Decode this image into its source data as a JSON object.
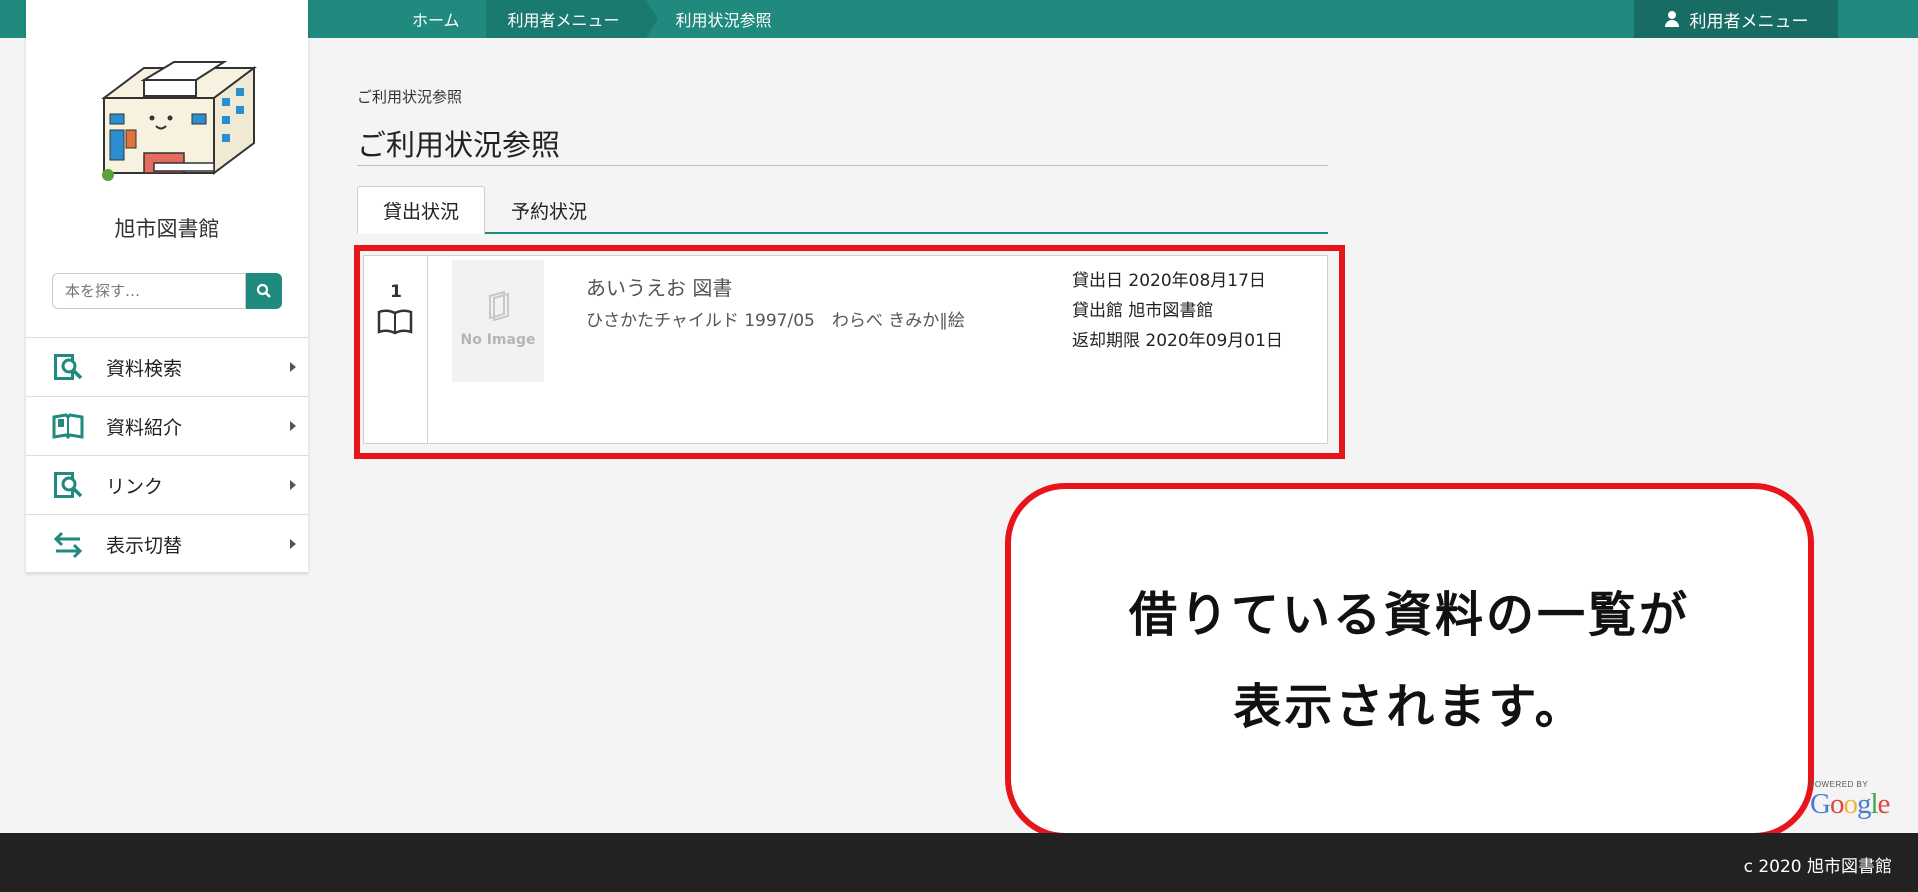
{
  "breadcrumb": {
    "items": [
      "ホーム",
      "利用者メニュー",
      "利用状況参照"
    ]
  },
  "user_menu": {
    "label": "利用者メニュー"
  },
  "sidebar": {
    "library_name": "旭市図書館",
    "search_placeholder": "本を探す…",
    "items": [
      {
        "label": "資料検索",
        "icon": "search-book-icon"
      },
      {
        "label": "資料紹介",
        "icon": "open-book-icon"
      },
      {
        "label": "リンク",
        "icon": "search-book-icon"
      },
      {
        "label": "表示切替",
        "icon": "swap-arrows-icon"
      }
    ]
  },
  "main": {
    "breadcrumb_small": "ご利用状況参照",
    "page_title": "ご利用状況参照",
    "tabs": [
      {
        "label": "貸出状況",
        "active": true
      },
      {
        "label": "予約状況",
        "active": false
      }
    ],
    "records": [
      {
        "number": "1",
        "image_placeholder": "No Image",
        "title": "あいうえお 図書",
        "subtitle": "ひさかたチャイルド 1997/05　わらべ きみか∥絵",
        "loan_date": "貸出日 2020年08月17日",
        "loan_library": "貸出館 旭市図書館",
        "due_date": "返却期限 2020年09月01日"
      }
    ]
  },
  "callout": {
    "line1": "借りている資料の一覧が",
    "line2": "表示されます。"
  },
  "powered_by": {
    "small": "POWERED BY",
    "logo": "Google"
  },
  "footer": {
    "copyright": "c 2020 旭市図書館"
  },
  "colors": {
    "accent": "#1f8a7d",
    "highlight": "#e8141c",
    "footer": "#222222"
  }
}
